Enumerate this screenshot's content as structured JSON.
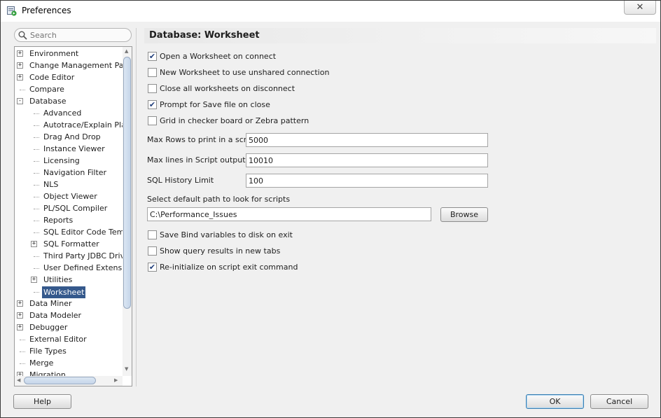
{
  "window": {
    "title": "Preferences",
    "close_glyph": "✕"
  },
  "search": {
    "placeholder": "Search",
    "value": ""
  },
  "tree": {
    "items": [
      {
        "label": "Environment",
        "level": 0,
        "toggle": "+"
      },
      {
        "label": "Change Management Paran",
        "level": 0,
        "toggle": "+"
      },
      {
        "label": "Code Editor",
        "level": 0,
        "toggle": "+"
      },
      {
        "label": "Compare",
        "level": 0,
        "toggle": ""
      },
      {
        "label": "Database",
        "level": 0,
        "toggle": "-"
      },
      {
        "label": "Advanced",
        "level": 1,
        "toggle": ""
      },
      {
        "label": "Autotrace/Explain Plan",
        "level": 1,
        "toggle": ""
      },
      {
        "label": "Drag And Drop",
        "level": 1,
        "toggle": ""
      },
      {
        "label": "Instance Viewer",
        "level": 1,
        "toggle": ""
      },
      {
        "label": "Licensing",
        "level": 1,
        "toggle": ""
      },
      {
        "label": "Navigation Filter",
        "level": 1,
        "toggle": ""
      },
      {
        "label": "NLS",
        "level": 1,
        "toggle": ""
      },
      {
        "label": "Object Viewer",
        "level": 1,
        "toggle": ""
      },
      {
        "label": "PL/SQL Compiler",
        "level": 1,
        "toggle": ""
      },
      {
        "label": "Reports",
        "level": 1,
        "toggle": ""
      },
      {
        "label": "SQL Editor Code Templa",
        "level": 1,
        "toggle": ""
      },
      {
        "label": "SQL Formatter",
        "level": 1,
        "toggle": "+"
      },
      {
        "label": "Third Party JDBC Driver",
        "level": 1,
        "toggle": ""
      },
      {
        "label": "User Defined Extension",
        "level": 1,
        "toggle": ""
      },
      {
        "label": "Utilities",
        "level": 1,
        "toggle": "+"
      },
      {
        "label": "Worksheet",
        "level": 1,
        "toggle": "",
        "selected": true
      },
      {
        "label": "Data Miner",
        "level": 0,
        "toggle": "+"
      },
      {
        "label": "Data Modeler",
        "level": 0,
        "toggle": "+"
      },
      {
        "label": "Debugger",
        "level": 0,
        "toggle": "+"
      },
      {
        "label": "External Editor",
        "level": 0,
        "toggle": ""
      },
      {
        "label": "File Types",
        "level": 0,
        "toggle": ""
      },
      {
        "label": "Merge",
        "level": 0,
        "toggle": ""
      },
      {
        "label": "Migration",
        "level": 0,
        "toggle": "+"
      }
    ]
  },
  "panel": {
    "title": "Database: Worksheet",
    "options_top": [
      {
        "label": "Open a Worksheet on connect",
        "checked": true
      },
      {
        "label": "New Worksheet to use unshared connection",
        "checked": false
      },
      {
        "label": "Close all worksheets on disconnect",
        "checked": false
      },
      {
        "label": "Prompt for Save file on close",
        "checked": true
      },
      {
        "label": "Grid in checker board or Zebra pattern",
        "checked": false
      }
    ],
    "max_rows_label": "Max Rows to print in a script",
    "max_rows_value": "5000",
    "max_lines_label": "Max lines in Script output",
    "max_lines_value": "10010",
    "history_label": "SQL History Limit",
    "history_value": "100",
    "path_label": "Select default path to look for scripts",
    "path_value": "C:\\Performance_Issues",
    "browse_label": "Browse",
    "options_bottom": [
      {
        "label": "Save Bind variables to disk on exit",
        "checked": false
      },
      {
        "label": "Show query results in new tabs",
        "checked": false
      },
      {
        "label": "Re-initialize on script exit command",
        "checked": true
      }
    ]
  },
  "footer": {
    "help_label": "Help",
    "ok_label": "OK",
    "cancel_label": "Cancel"
  },
  "colors": {
    "selection": "#35598c",
    "accent_check": "#1f3d7a"
  },
  "check_glyph": "✔"
}
